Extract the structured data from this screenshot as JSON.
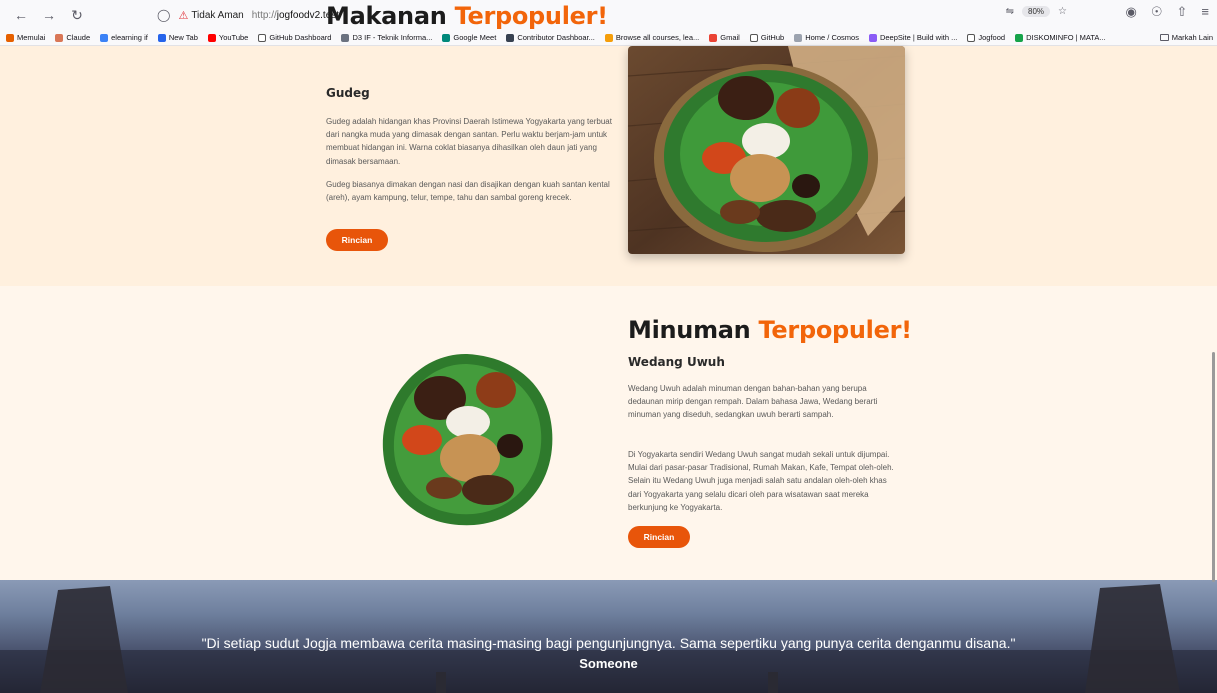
{
  "browser": {
    "insecure_label": "Tidak Aman",
    "url_protocol": "http://",
    "url_host": "jogfoodv2.test",
    "zoom": "80%",
    "bookmarks": [
      {
        "label": "Memulai",
        "color": "#e66000"
      },
      {
        "label": "Claude",
        "color": "#d97757"
      },
      {
        "label": "elearning if",
        "color": "#3b82f6"
      },
      {
        "label": "New Tab",
        "color": "#2563eb"
      },
      {
        "label": "YouTube",
        "color": "#ff0000"
      },
      {
        "label": "GitHub Dashboard",
        "color": "#ffffff"
      },
      {
        "label": "D3 IF - Teknik Informa...",
        "color": "#6b7280"
      },
      {
        "label": "Google Meet",
        "color": "#00897b"
      },
      {
        "label": "Contributor Dashboar...",
        "color": "#374151"
      },
      {
        "label": "Browse all courses, lea...",
        "color": "#f59e0b"
      },
      {
        "label": "Gmail",
        "color": "#ea4335"
      },
      {
        "label": "GitHub",
        "color": "#ffffff"
      },
      {
        "label": "Home / Cosmos",
        "color": "#9ca3af"
      },
      {
        "label": "DeepSite | Build with ...",
        "color": "#8b5cf6"
      },
      {
        "label": "Jogfood",
        "color": "#ffffff"
      },
      {
        "label": "DISKOMINFO | MATA...",
        "color": "#16a34a"
      }
    ],
    "other_bookmarks": "Markah Lain"
  },
  "food": {
    "title_main": "Makanan",
    "title_accent": "Terpopuler!",
    "name": "Gudeg",
    "paragraph1": "Gudeg adalah hidangan khas Provinsi Daerah Istimewa Yogyakarta yang terbuat dari nangka muda yang dimasak dengan santan. Perlu waktu berjam-jam untuk membuat hidangan ini. Warna coklat biasanya dihasilkan oleh daun jati yang dimasak bersamaan.",
    "paragraph2": "Gudeg biasanya dimakan dengan nasi dan disajikan dengan kuah santan kental (areh), ayam kampung, telur, tempe, tahu dan sambal goreng krecek.",
    "button": "Rincian"
  },
  "drink": {
    "title_main": "Minuman",
    "title_accent": "Terpopuler!",
    "name": "Wedang Uwuh",
    "paragraph1": "Wedang Uwuh adalah minuman dengan bahan-bahan yang berupa dedaunan mirip dengan rempah. Dalam bahasa Jawa, Wedang berarti minuman yang diseduh, sedangkan uwuh berarti sampah.",
    "paragraph2": "Di Yogyakarta sendiri Wedang Uwuh sangat mudah sekali untuk dijumpai. Mulai dari pasar-pasar Tradisional, Rumah Makan, Kafe, Tempat oleh-oleh. Selain itu Wedang Uwuh juga menjadi salah satu andalan oleh-oleh khas dari Yogyakarta yang selalu dicari oleh para wisatawan saat mereka berkunjung ke Yogyakarta.",
    "button": "Rincian"
  },
  "quote": {
    "text": "\"Di setiap sudut Jogja membawa cerita masing-masing bagi pengunjungnya. Sama sepertiku yang punya cerita denganmu disana.\"",
    "author": "Someone"
  },
  "colors": {
    "accent": "#f2650a",
    "button": "#e8550a",
    "food_bg": "#fff0de",
    "drink_bg": "#fff6ec"
  }
}
